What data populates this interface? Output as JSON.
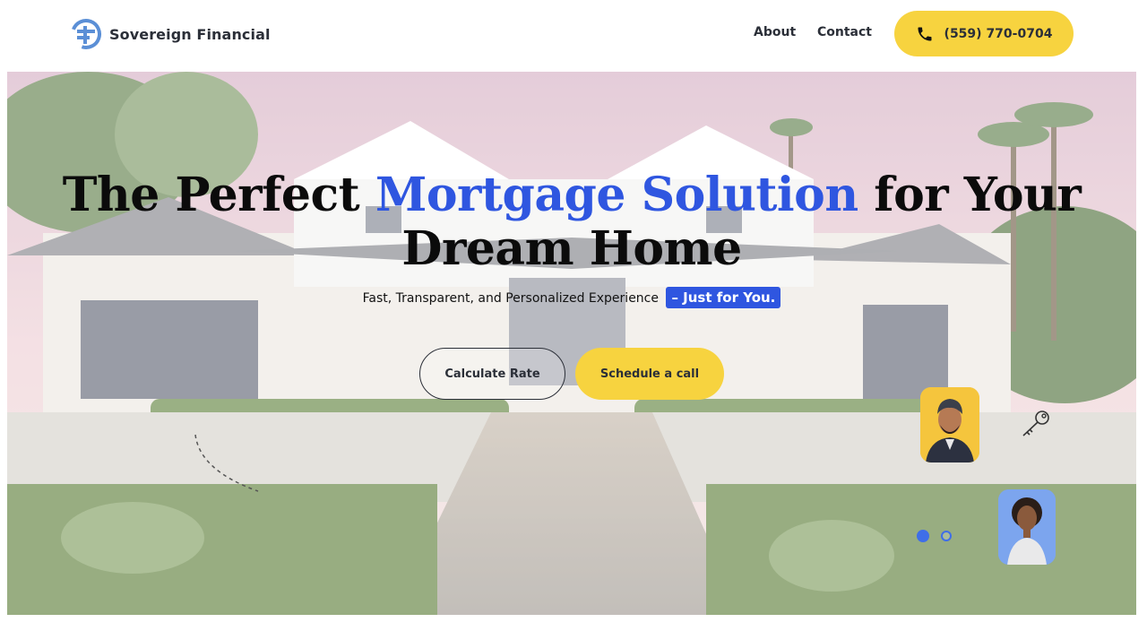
{
  "header": {
    "brand": "Sovereign Financial",
    "logo_icon": "sf-monogram-logo",
    "nav": [
      {
        "label": "About"
      },
      {
        "label": "Contact"
      }
    ],
    "phone": {
      "label": "(559) 770-0704",
      "icon": "phone-icon"
    }
  },
  "hero": {
    "headline_part1": "The Perfect ",
    "headline_accent": "Mortgage Solution",
    "headline_part2": " for Your Dream Home",
    "subline": "Fast, Transparent, and Personalized Experience",
    "subline_accent": "– Just for You.",
    "primary_button": "Schedule a call",
    "secondary_button": "Calculate Rate",
    "carousel": {
      "total_slides": 2,
      "active_slide": 1
    }
  },
  "colors": {
    "accent_blue": "#2f56e0",
    "accent_yellow": "#f7d33f",
    "text_dark": "#2b2f38"
  }
}
